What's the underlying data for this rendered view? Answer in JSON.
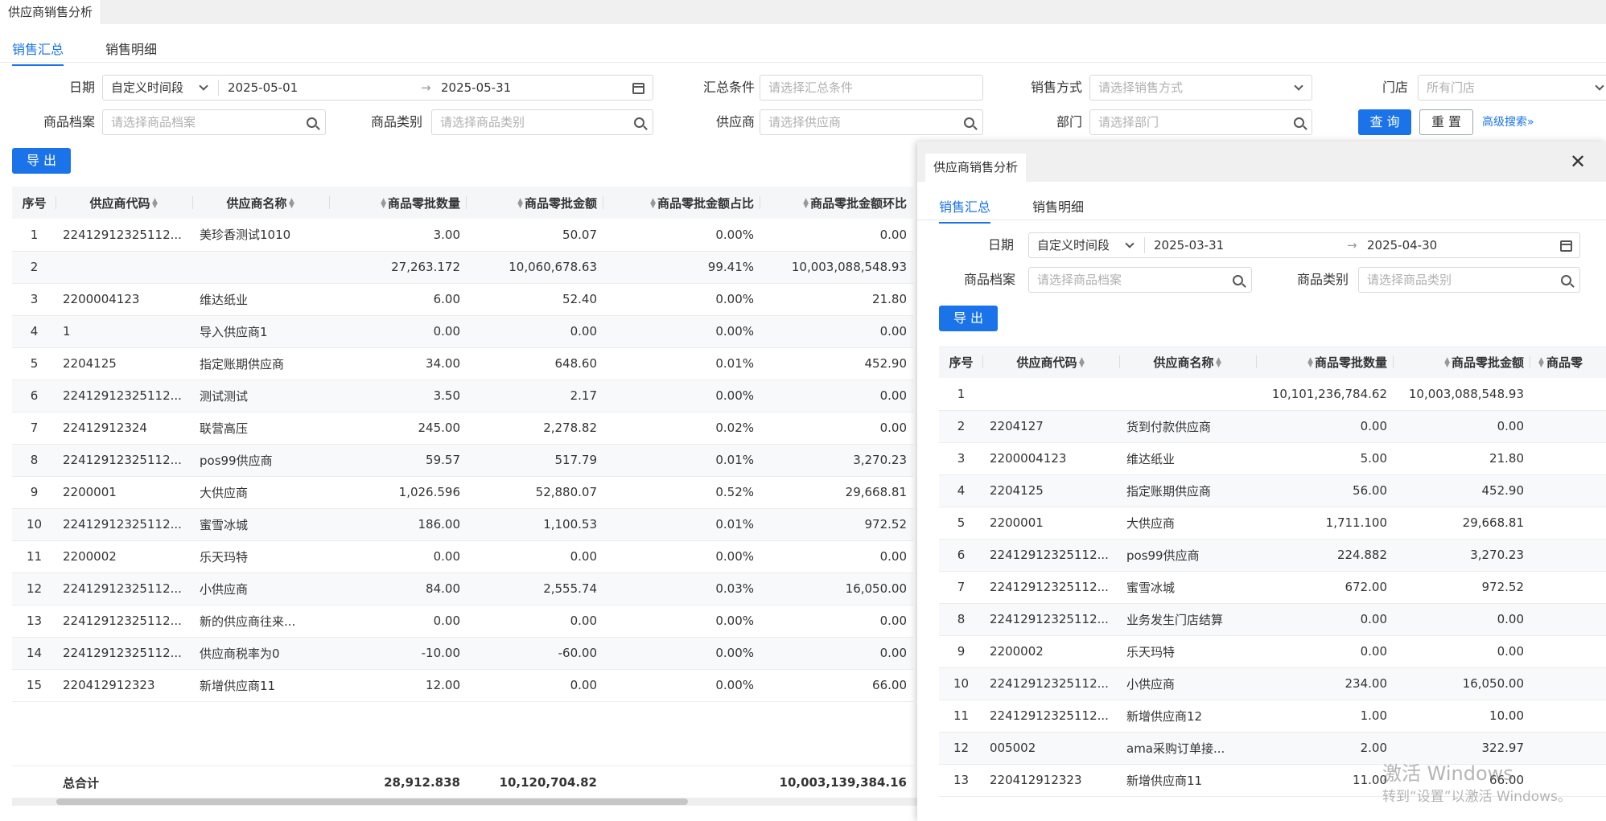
{
  "page_tab": "供应商销售分析",
  "sub_tabs": [
    "销售汇总",
    "销售明细"
  ],
  "filters": {
    "date_label": "日期",
    "date_mode": "自定义时间段",
    "date_start": "2025-05-01",
    "date_end": "2025-05-31",
    "date_arrow": "→",
    "summary_label": "汇总条件",
    "summary_placeholder": "请选择汇总条件",
    "sale_mode_label": "销售方式",
    "sale_mode_placeholder": "请选择销售方式",
    "store_label": "门店",
    "store_placeholder": "所有门店",
    "product_label": "商品档案",
    "product_placeholder": "请选择商品档案",
    "category_label": "商品类别",
    "category_placeholder": "请选择商品类别",
    "supplier_label": "供应商",
    "supplier_placeholder": "请选择供应商",
    "dept_label": "部门",
    "dept_placeholder": "请选择部门",
    "query_button": "查 询",
    "reset_button": "重 置",
    "advanced_link": "高级搜索»"
  },
  "export_button": "导 出",
  "main_table": {
    "columns": [
      "序号",
      "供应商代码",
      "供应商名称",
      "商品零批数量",
      "商品零批金额",
      "商品零批金额占比",
      "商品零批金额环比"
    ],
    "rows": [
      [
        "1",
        "22412912325112...",
        "美珍香测试1010",
        "3.00",
        "50.07",
        "0.00%",
        "0.00"
      ],
      [
        "2",
        "",
        "",
        "27,263.172",
        "10,060,678.63",
        "99.41%",
        "10,003,088,548.93"
      ],
      [
        "3",
        "2200004123",
        "维达纸业",
        "6.00",
        "52.40",
        "0.00%",
        "21.80"
      ],
      [
        "4",
        "1",
        "导入供应商1",
        "0.00",
        "0.00",
        "0.00%",
        "0.00"
      ],
      [
        "5",
        "2204125",
        "指定账期供应商",
        "34.00",
        "648.60",
        "0.01%",
        "452.90"
      ],
      [
        "6",
        "22412912325112...",
        "测试测试",
        "3.50",
        "2.17",
        "0.00%",
        "0.00"
      ],
      [
        "7",
        "22412912324",
        "联营高压",
        "245.00",
        "2,278.82",
        "0.02%",
        "0.00"
      ],
      [
        "8",
        "22412912325112...",
        "pos99供应商",
        "59.57",
        "517.79",
        "0.01%",
        "3,270.23"
      ],
      [
        "9",
        "2200001",
        "大供应商",
        "1,026.596",
        "52,880.07",
        "0.52%",
        "29,668.81"
      ],
      [
        "10",
        "22412912325112...",
        "蜜雪冰城",
        "186.00",
        "1,100.53",
        "0.01%",
        "972.52"
      ],
      [
        "11",
        "2200002",
        "乐天玛特",
        "0.00",
        "0.00",
        "0.00%",
        "0.00"
      ],
      [
        "12",
        "22412912325112...",
        "小供应商",
        "84.00",
        "2,555.74",
        "0.03%",
        "16,050.00"
      ],
      [
        "13",
        "22412912325112...",
        "新的供应商往来...",
        "0.00",
        "0.00",
        "0.00%",
        "0.00"
      ],
      [
        "14",
        "22412912325112...",
        "供应商税率为0",
        "-10.00",
        "-60.00",
        "0.00%",
        "0.00"
      ],
      [
        "15",
        "220412912323",
        "新增供应商11",
        "12.00",
        "0.00",
        "0.00%",
        "66.00"
      ]
    ],
    "footer": {
      "label": "总合计",
      "qty": "28,912.838",
      "amount": "10,120,704.82",
      "mom": "10,003,139,384.16"
    }
  },
  "dialog": {
    "tab": "供应商销售分析",
    "sub_tabs": [
      "销售汇总",
      "销售明细"
    ],
    "date_label": "日期",
    "date_mode": "自定义时间段",
    "date_start": "2025-03-31",
    "date_end": "2025-04-30",
    "date_arrow": "→",
    "product_label": "商品档案",
    "product_placeholder": "请选择商品档案",
    "category_label": "商品类别",
    "category_placeholder": "请选择商品类别",
    "export_button": "导 出",
    "columns": [
      "序号",
      "供应商代码",
      "供应商名称",
      "商品零批数量",
      "商品零批金额",
      "商品零"
    ],
    "rows": [
      [
        "1",
        "",
        "",
        "10,101,236,784.62",
        "10,003,088,548.93"
      ],
      [
        "2",
        "2204127",
        "货到付款供应商",
        "0.00",
        "0.00"
      ],
      [
        "3",
        "2200004123",
        "维达纸业",
        "5.00",
        "21.80"
      ],
      [
        "4",
        "2204125",
        "指定账期供应商",
        "56.00",
        "452.90"
      ],
      [
        "5",
        "2200001",
        "大供应商",
        "1,711.100",
        "29,668.81"
      ],
      [
        "6",
        "22412912325112...",
        "pos99供应商",
        "224.882",
        "3,270.23"
      ],
      [
        "7",
        "22412912325112...",
        "蜜雪冰城",
        "672.00",
        "972.52"
      ],
      [
        "8",
        "22412912325112...",
        "业务发生门店结算",
        "0.00",
        "0.00"
      ],
      [
        "9",
        "2200002",
        "乐天玛特",
        "0.00",
        "0.00"
      ],
      [
        "10",
        "22412912325112...",
        "小供应商",
        "234.00",
        "16,050.00"
      ],
      [
        "11",
        "22412912325112...",
        "新增供应商12",
        "1.00",
        "10.00"
      ],
      [
        "12",
        "005002",
        "ama采购订单接...",
        "2.00",
        "322.97"
      ],
      [
        "13",
        "220412912323",
        "新增供应商11",
        "11.00",
        "66.00"
      ]
    ]
  },
  "watermark": {
    "line1": "激活 Windows",
    "line2": "转到“设置”以激活 Windows。"
  }
}
